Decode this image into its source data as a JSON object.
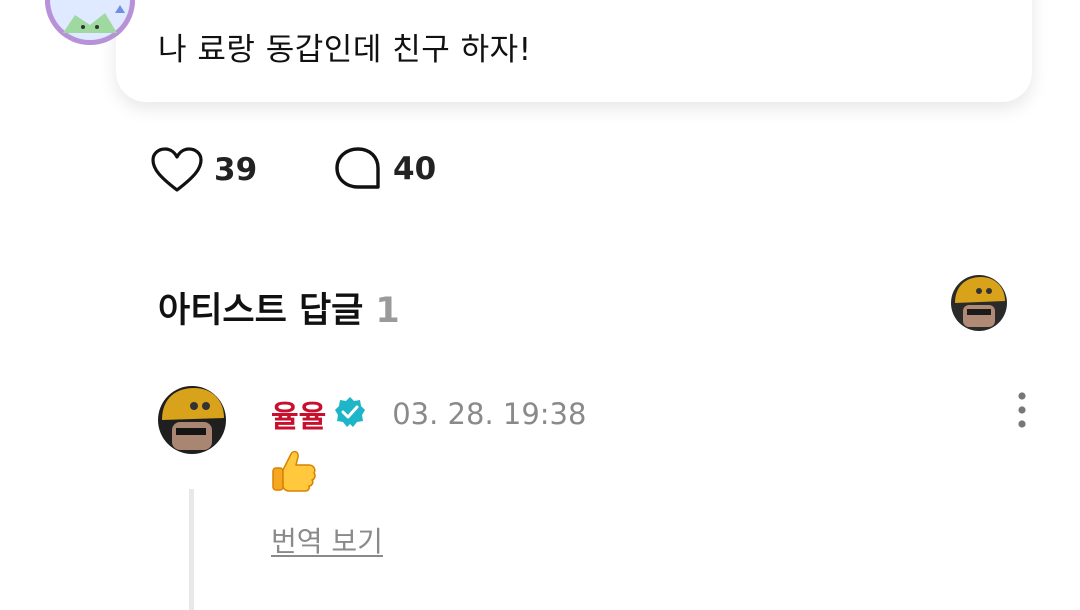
{
  "comment": {
    "text": "나 료랑 동갑인데 친구 하자!",
    "avatar_icon": "character-avatar-icon"
  },
  "reactions": {
    "likes": "39",
    "comments": "40",
    "like_icon": "heart-icon",
    "comment_icon": "speech-bubble-icon"
  },
  "artist_replies": {
    "title": "아티스트 답글",
    "count": "1",
    "avatar_icon": "artist-avatar-icon"
  },
  "reply": {
    "author": "율율",
    "verified_icon": "verified-badge-icon",
    "timestamp": "03. 28. 19:38",
    "emoji": "👍",
    "translate_label": "번역 보기",
    "more_icon": "more-vertical-icon"
  },
  "colors": {
    "author_name": "#c8102e",
    "verified": "#1eb5c9",
    "muted": "#8a8a8a",
    "section_count": "#9a9a9a"
  }
}
